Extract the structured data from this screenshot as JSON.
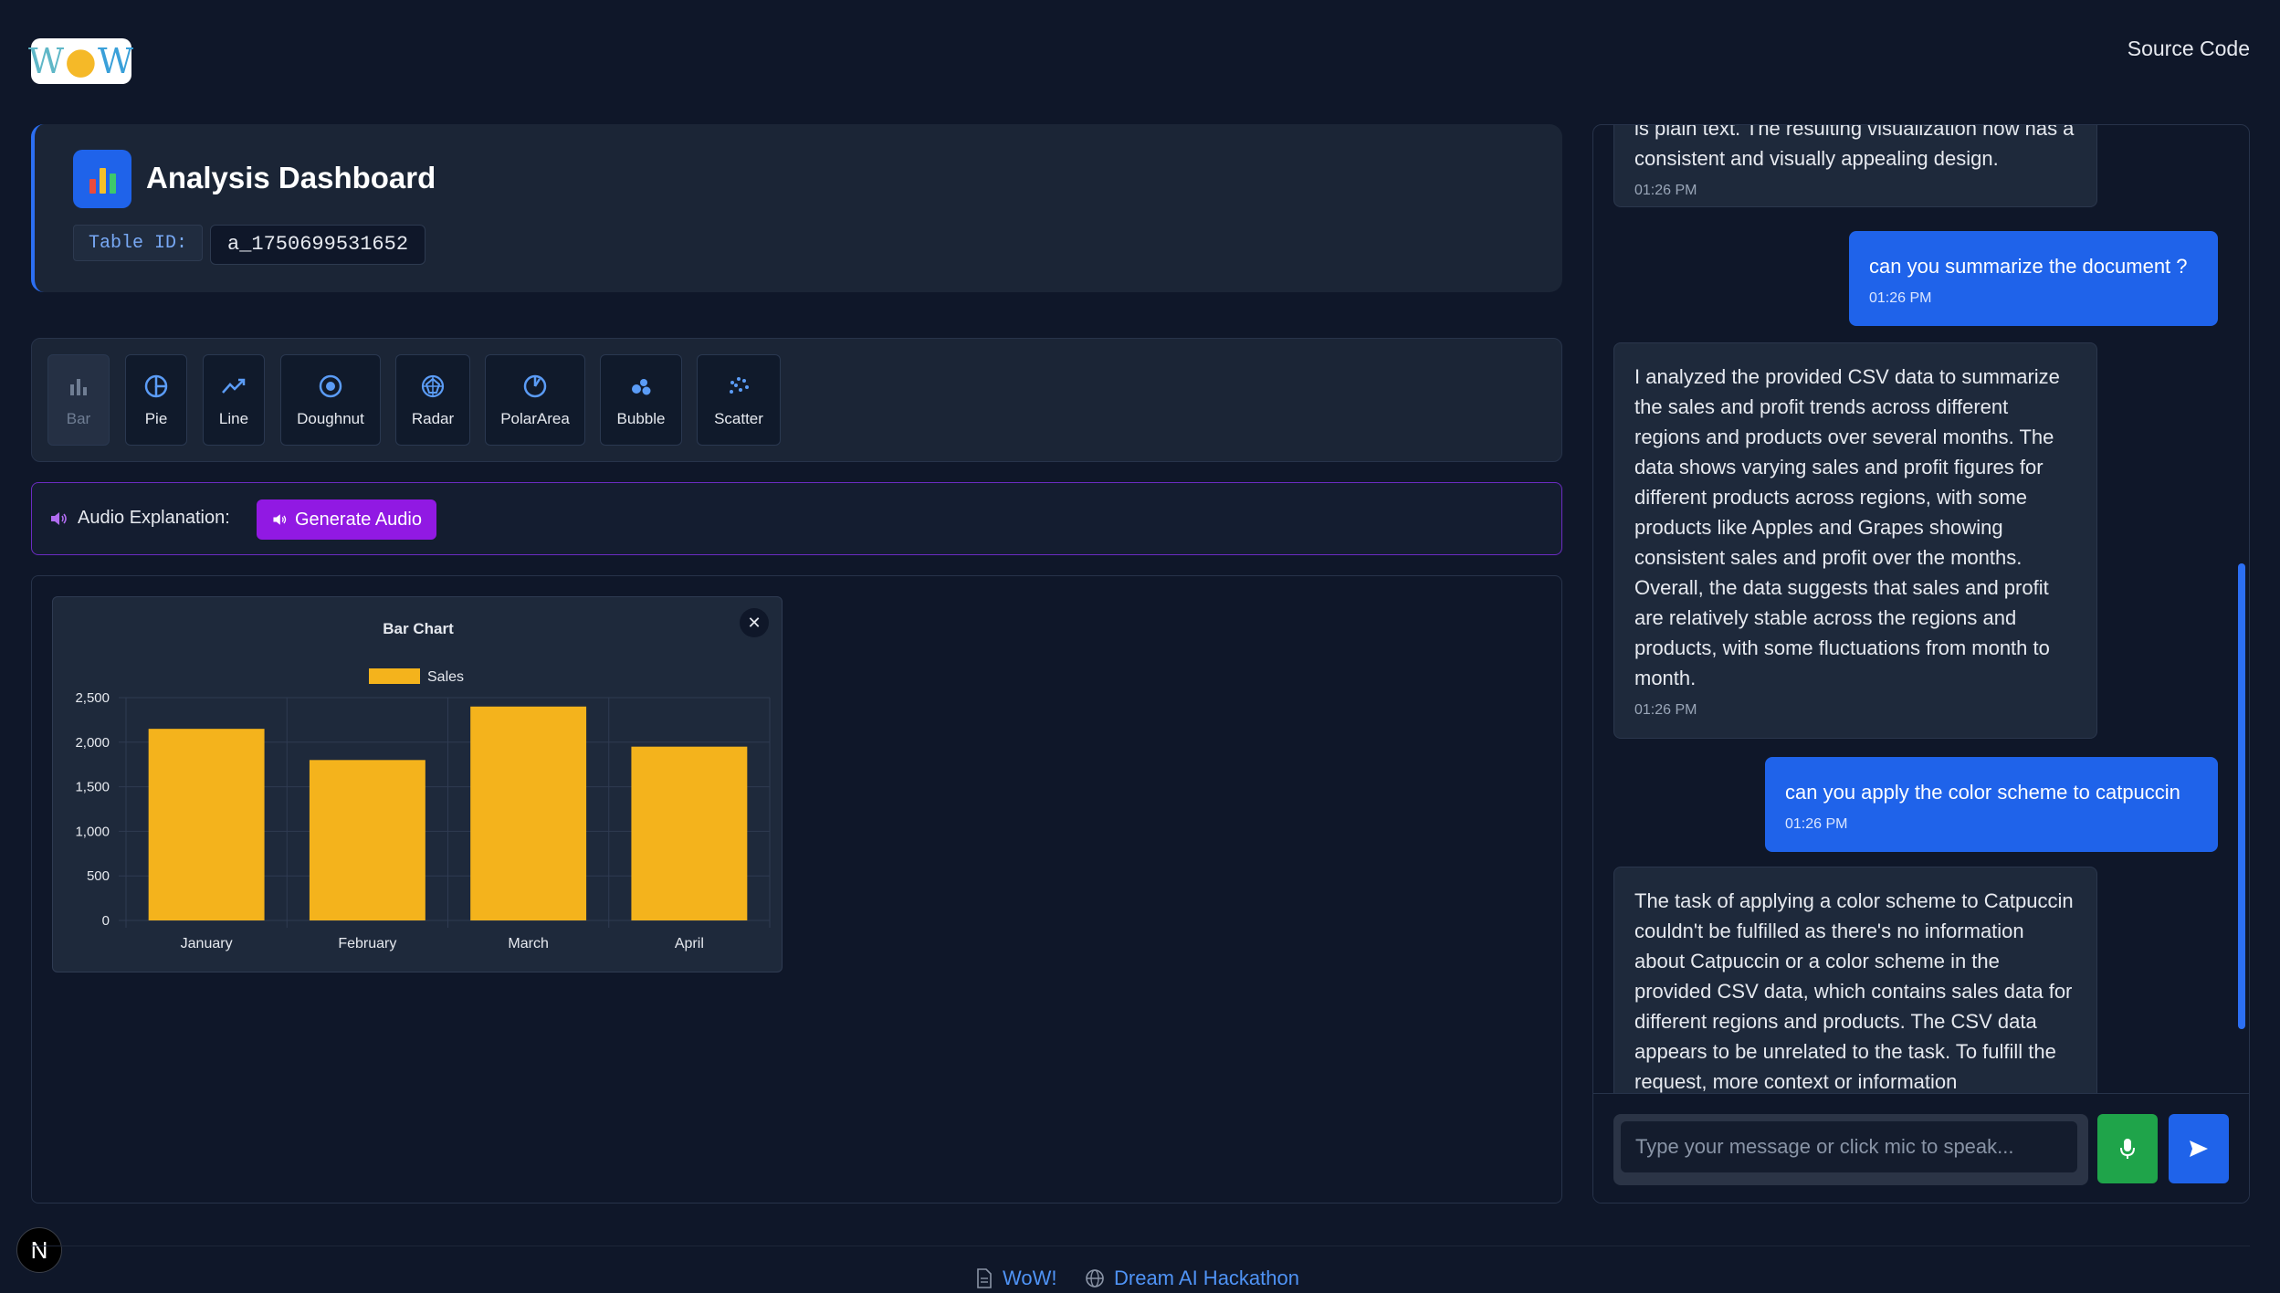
{
  "header": {
    "logo_text": "WoW",
    "source_code_label": "Source Code"
  },
  "dashboard": {
    "icon": "bar-chart-emoji-icon",
    "title": "Analysis Dashboard",
    "table_id_label": "Table ID:",
    "table_id_value": "a_1750699531652"
  },
  "chart_types": [
    {
      "label": "Bar",
      "icon": "bar-chart-icon",
      "active": true
    },
    {
      "label": "Pie",
      "icon": "pie-chart-icon",
      "active": false
    },
    {
      "label": "Line",
      "icon": "trend-line-icon",
      "active": false
    },
    {
      "label": "Doughnut",
      "icon": "doughnut-icon",
      "active": false
    },
    {
      "label": "Radar",
      "icon": "radar-icon",
      "active": false
    },
    {
      "label": "PolarArea",
      "icon": "polar-area-icon",
      "active": false
    },
    {
      "label": "Bubble",
      "icon": "bubble-icon",
      "active": false
    },
    {
      "label": "Scatter",
      "icon": "scatter-icon",
      "active": false
    }
  ],
  "audio": {
    "label": "Audio Explanation:",
    "button_label": "Generate Audio",
    "icon": "speaker-icon"
  },
  "chart_data": {
    "type": "bar",
    "title": "Bar Chart",
    "categories": [
      "January",
      "February",
      "March",
      "April"
    ],
    "series": [
      {
        "name": "Sales",
        "values": [
          2150,
          1800,
          2400,
          1950
        ]
      }
    ],
    "ylim": [
      0,
      2500
    ],
    "yticks": [
      "0",
      "500",
      "1,000",
      "1,500",
      "2,000",
      "2,500"
    ],
    "grid": true,
    "legend": "top",
    "colors": {
      "bar": "#f4b31c",
      "grid": "#2f3b52",
      "text": "#e6e9ef"
    }
  },
  "chat": {
    "messages": [
      {
        "role": "bot",
        "text": "is plain text. The resulting visualization now has a consistent and visually appealing design.",
        "time": "01:26 PM"
      },
      {
        "role": "user",
        "text": "can you summarize the document ?",
        "time": "01:26 PM"
      },
      {
        "role": "bot",
        "text": "I analyzed the provided CSV data to summarize the sales and profit trends across different regions and products over several months. The data shows varying sales and profit figures for different products across regions, with some products like Apples and Grapes showing consistent sales and profit over the months. Overall, the data suggests that sales and profit are relatively stable across the regions and products, with some fluctuations from month to month.",
        "time": "01:26 PM"
      },
      {
        "role": "user",
        "text": "can you apply the color scheme to catpuccin",
        "time": "01:26 PM"
      },
      {
        "role": "bot",
        "text": "The task of applying a color scheme to Catpuccin couldn't be fulfilled as there's no information about Catpuccin or a color scheme in the provided CSV data, which contains sales data for different regions and products. The CSV data appears to be unrelated to the task. To fulfill the request, more context or information",
        "time": ""
      }
    ],
    "input_placeholder": "Type your message or click mic to speak...",
    "mic_icon": "microphone-icon",
    "send_icon": "send-icon"
  },
  "badge": {
    "letter": "N"
  },
  "footer": {
    "links": [
      {
        "label": "WoW!",
        "icon": "document-icon"
      },
      {
        "label": "Dream AI Hackathon",
        "icon": "globe-icon"
      }
    ]
  }
}
